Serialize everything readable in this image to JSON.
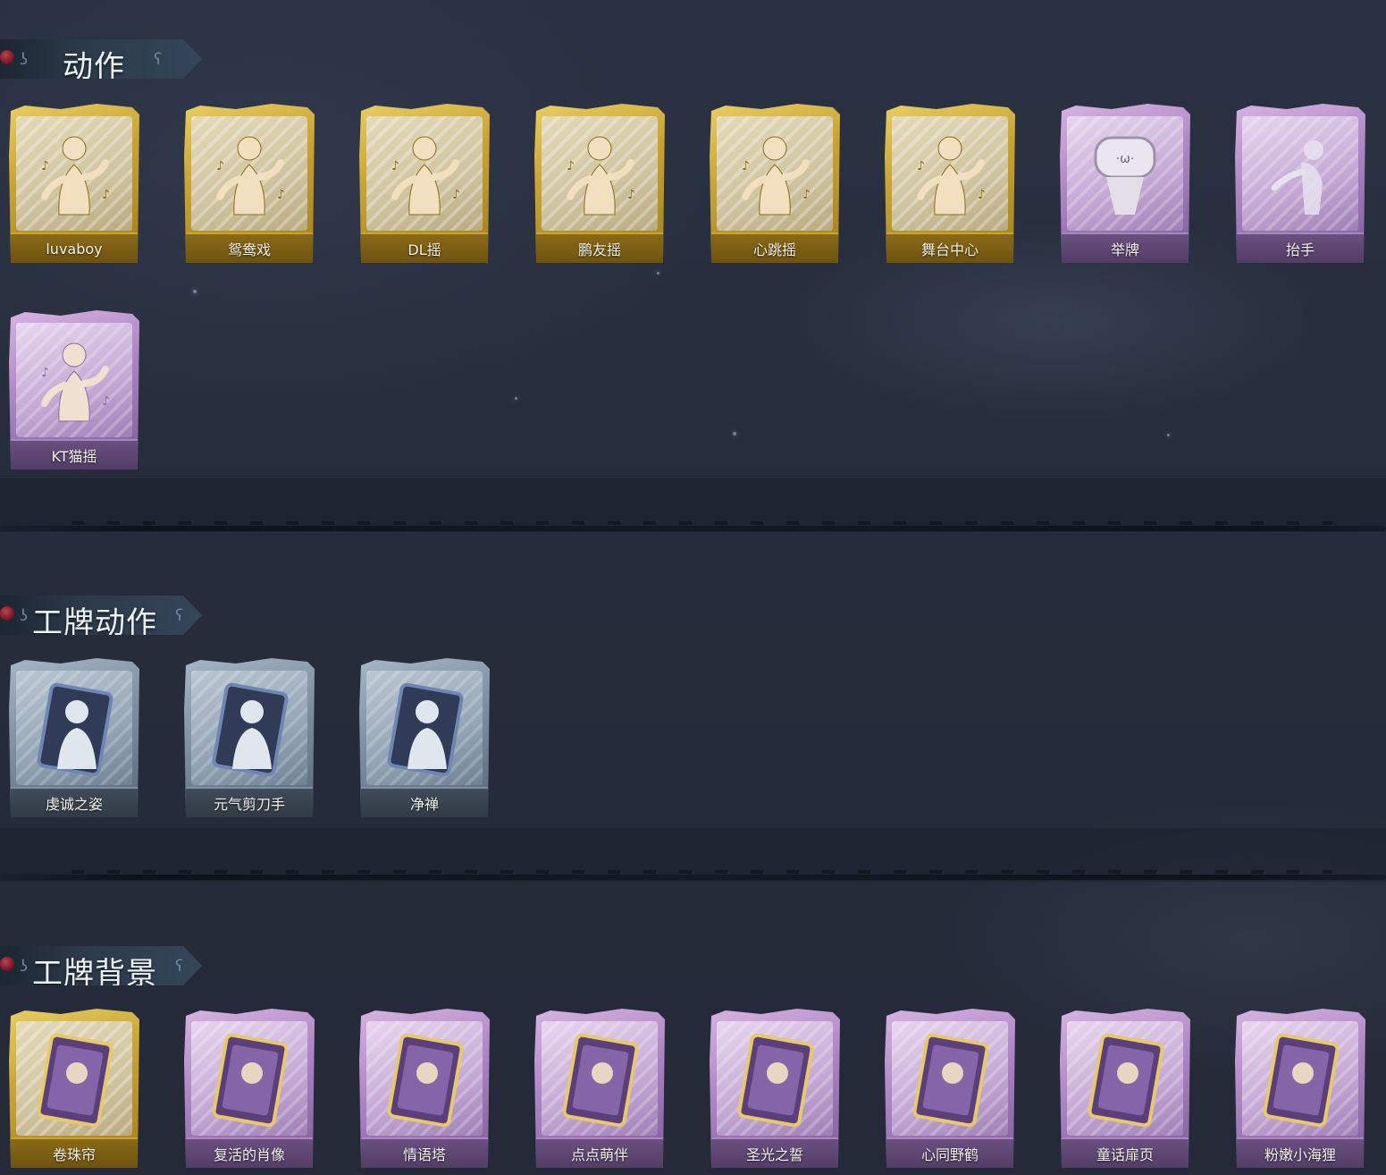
{
  "sections": {
    "actions": {
      "title": "动作",
      "items": [
        {
          "label": "luvaboy",
          "rarity": "gold",
          "icon": "dance-figure-icon"
        },
        {
          "label": "鸳鸯戏",
          "rarity": "gold",
          "icon": "dance-figure-icon"
        },
        {
          "label": "DL摇",
          "rarity": "gold",
          "icon": "dance-figure-icon"
        },
        {
          "label": "鹏友摇",
          "rarity": "gold",
          "icon": "dance-figure-icon"
        },
        {
          "label": "心跳摇",
          "rarity": "gold",
          "icon": "dance-figure-icon"
        },
        {
          "label": "舞台中心",
          "rarity": "gold",
          "icon": "dance-figure-icon"
        },
        {
          "label": "举牌",
          "rarity": "purple",
          "icon": "sign-holding-icon"
        },
        {
          "label": "抬手",
          "rarity": "purple",
          "icon": "raise-hand-icon"
        },
        {
          "label": "KT猫摇",
          "rarity": "purple",
          "icon": "dance-figure-icon"
        }
      ]
    },
    "badge_actions": {
      "title": "工牌动作",
      "items": [
        {
          "label": "虔诚之姿",
          "rarity": "blue",
          "icon": "badge-pose-icon"
        },
        {
          "label": "元气剪刀手",
          "rarity": "blue",
          "icon": "badge-pose-icon"
        },
        {
          "label": "净禅",
          "rarity": "blue",
          "icon": "badge-pose-icon"
        }
      ]
    },
    "badge_backgrounds": {
      "title": "工牌背景",
      "items": [
        {
          "label": "卷珠帘",
          "rarity": "gold",
          "icon": "background-card-icon"
        },
        {
          "label": "复活的肖像",
          "rarity": "purple",
          "icon": "background-card-icon"
        },
        {
          "label": "情语塔",
          "rarity": "purple",
          "icon": "background-card-icon"
        },
        {
          "label": "点点萌伴",
          "rarity": "purple",
          "icon": "background-card-icon"
        },
        {
          "label": "圣光之誓",
          "rarity": "purple",
          "icon": "background-card-icon"
        },
        {
          "label": "心同野鹤",
          "rarity": "purple",
          "icon": "background-card-icon"
        },
        {
          "label": "童话扉页",
          "rarity": "purple",
          "icon": "background-card-icon"
        },
        {
          "label": "粉嫩小海狸",
          "rarity": "purple",
          "icon": "background-card-icon"
        }
      ]
    }
  },
  "colors": {
    "gold": "#c9a434",
    "purple": "#ad84c4",
    "blue": "#7d8fa1",
    "background": "#262c3b",
    "title_text": "#eef1f5"
  }
}
